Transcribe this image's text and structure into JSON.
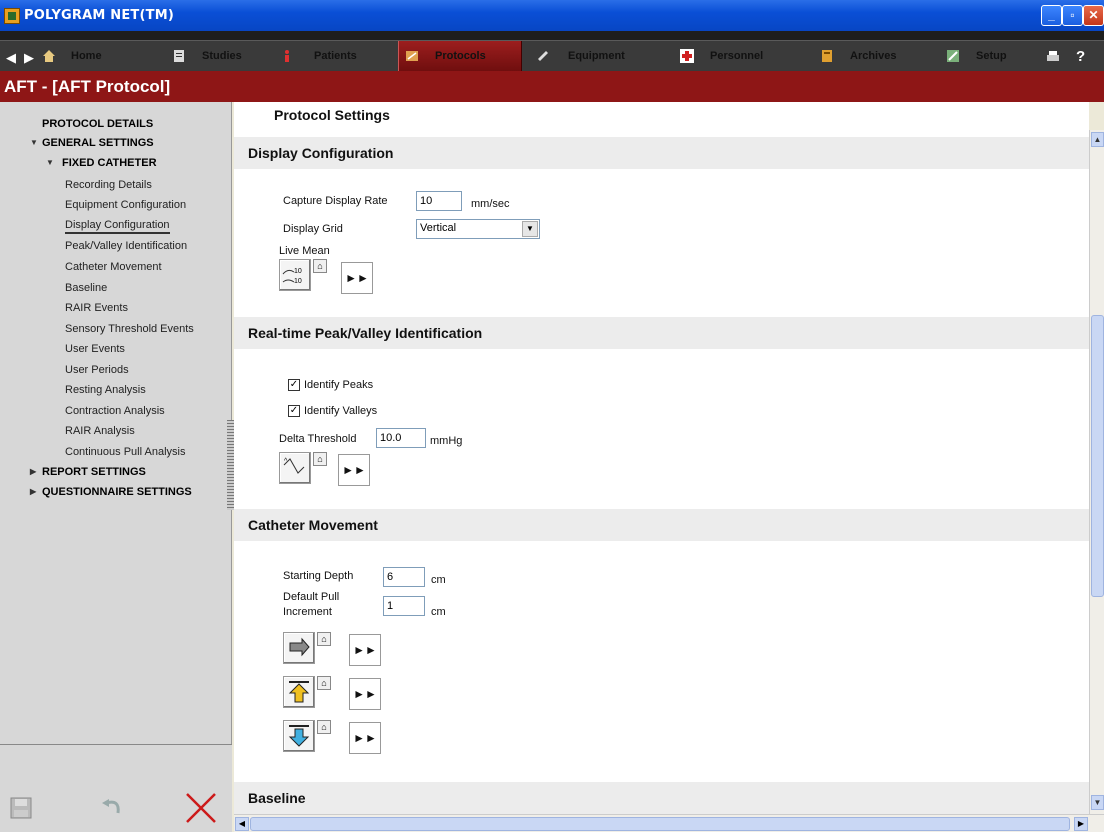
{
  "window": {
    "title": "POLYGRAM NET(TM)"
  },
  "nav": {
    "items": [
      {
        "label": "Home"
      },
      {
        "label": "Studies"
      },
      {
        "label": "Patients"
      },
      {
        "label": "Protocols"
      },
      {
        "label": "Equipment"
      },
      {
        "label": "Personnel"
      },
      {
        "label": "Archives"
      },
      {
        "label": "Setup"
      }
    ],
    "active": "Protocols",
    "help_label": "?"
  },
  "header": {
    "title": "AFT - [AFT Protocol]"
  },
  "tree": {
    "protocol_details": "PROTOCOL DETAILS",
    "general_settings": "GENERAL SETTINGS",
    "fixed_catheter": "FIXED CATHETER",
    "items": [
      "Recording Details",
      "Equipment Configuration",
      "Display Configuration",
      "Peak/Valley Identification",
      "Catheter Movement",
      "Baseline",
      "RAIR Events",
      "Sensory Threshold Events",
      "User Events",
      "User Periods",
      "Resting Analysis",
      "Contraction Analysis",
      "RAIR Analysis",
      "Continuous Pull Analysis"
    ],
    "selected": "Display Configuration",
    "report_settings": "REPORT SETTINGS",
    "questionnaire_settings": "QUESTIONNAIRE SETTINGS"
  },
  "main": {
    "heading": "Protocol Settings",
    "display_config": {
      "title": "Display Configuration",
      "capture_rate_label": "Capture Display Rate",
      "capture_rate_value": "10",
      "capture_rate_unit": "mm/sec",
      "grid_label": "Display Grid",
      "grid_value": "Vertical",
      "live_mean_label": "Live Mean"
    },
    "peak_valley": {
      "title": "Real-time Peak/Valley Identification",
      "identify_peaks": "Identify Peaks",
      "identify_peaks_checked": true,
      "identify_valleys": "Identify Valleys",
      "identify_valleys_checked": true,
      "delta_label": "Delta Threshold",
      "delta_value": "10.0",
      "delta_unit": "mmHg"
    },
    "catheter": {
      "title": "Catheter Movement",
      "start_depth_label": "Starting Depth",
      "start_depth_value": "6",
      "start_depth_unit": "cm",
      "pull_label_1": "Default Pull",
      "pull_label_2": "Increment",
      "pull_value": "1",
      "pull_unit": "cm"
    },
    "baseline": {
      "title": "Baseline"
    }
  },
  "colors": {
    "header_bg": "#8e1616",
    "nav_bg": "#3a3a3a",
    "title_bg": "#0a4fd6"
  }
}
